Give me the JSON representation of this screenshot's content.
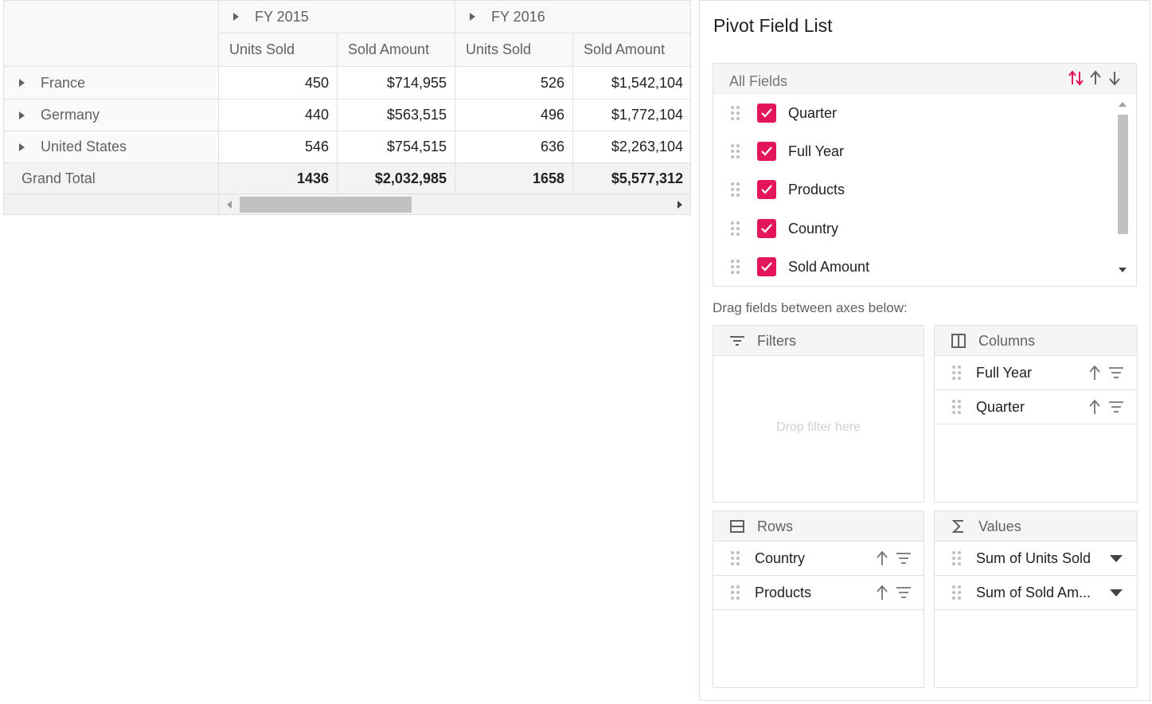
{
  "grid": {
    "years": [
      {
        "label": "FY 2015"
      },
      {
        "label": "FY 2016"
      }
    ],
    "measure_headers": [
      "Units Sold",
      "Sold Amount",
      "Units Sold",
      "Sold Amount"
    ],
    "rows": [
      {
        "label": "France",
        "values": [
          "450",
          "$714,955",
          "526",
          "$1,542,104"
        ]
      },
      {
        "label": "Germany",
        "values": [
          "440",
          "$563,515",
          "496",
          "$1,772,104"
        ]
      },
      {
        "label": "United States",
        "values": [
          "546",
          "$754,515",
          "636",
          "$2,263,104"
        ]
      }
    ],
    "grand_total": {
      "label": "Grand Total",
      "values": [
        "1436",
        "$2,032,985",
        "1658",
        "$5,577,312"
      ]
    }
  },
  "field_list": {
    "title": "Pivot Field List",
    "all_fields_label": "All Fields",
    "fields": [
      "Quarter",
      "Full Year",
      "Products",
      "Country",
      "Sold Amount"
    ],
    "drag_hint": "Drag fields between axes below:",
    "filters": {
      "label": "Filters",
      "placeholder": "Drop filter here"
    },
    "columns": {
      "label": "Columns",
      "items": [
        "Full Year",
        "Quarter"
      ]
    },
    "rows": {
      "label": "Rows",
      "items": [
        "Country",
        "Products"
      ]
    },
    "values": {
      "label": "Values",
      "items": [
        "Sum of Units Sold",
        "Sum of Sold Am..."
      ]
    }
  },
  "colors": {
    "accent": "#e3165b",
    "header_bg": "#f8f8f8",
    "border": "#e0e0e0",
    "scroll_thumb": "#c1c1c1"
  },
  "icons": [
    "caret-right-icon",
    "sort-none-icon",
    "sort-ascending-icon",
    "sort-descending-icon",
    "drag-handle-icon",
    "check-icon",
    "filter-icon",
    "columns-icon",
    "rows-icon",
    "sigma-icon",
    "dropdown-caret-icon"
  ]
}
